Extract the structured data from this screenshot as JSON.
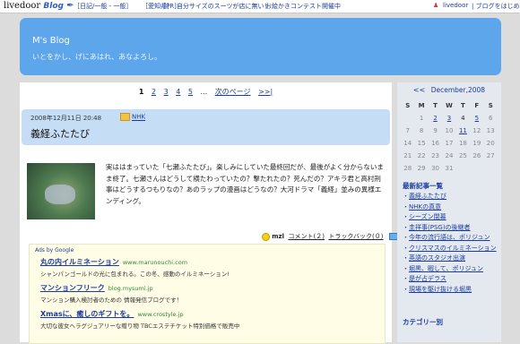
{
  "topbar": {
    "logo_text": "livedoor",
    "logo_blog": "Blog",
    "link1": "［日記/一般 - 一般］",
    "link2": "［愛知県］",
    "link3": "［PR]自分サイズのスーツが店に無い！",
    "link4": "お絵かきコンテスト開催中",
    "right1": "livedoor",
    "right2": "| ブログをはじめる"
  },
  "header": {
    "title": "M's Blog",
    "description": "いとをかし、げにあはれ、あなよろし。"
  },
  "pager": {
    "pages": [
      "1",
      "2",
      "3",
      "4",
      "5"
    ],
    "ellipsis": "...",
    "next": "次のページ",
    "last": ">>|"
  },
  "post": {
    "date": "2008年12月11日 20:48",
    "category": "NHK",
    "title": "義経ふたたび",
    "body": "実ははまっていた「七瀬ふたたび」。楽しみにしていた最終回だが、最後がよく分からないまま終了。七瀬さんはどうして横たわっていたの？撃たれたの？死んだの？アキラ君と高村刑事はどうするつもりなの？あのラップの漫画はどうなの？大河ドラマ「義経」並みの異様エンディング。",
    "author": "mzl",
    "comments": "コメント(２)",
    "trackback": "トラックバック(０)"
  },
  "ads": {
    "label": "Ads by Google",
    "items": [
      {
        "title": "丸の内イルミネーション",
        "url": "www.marunouchi.com",
        "desc": "シャンパンゴールドの光に包まれる。この冬、感動のイルミネーション!"
      },
      {
        "title": "マンションフリーク",
        "url": "blog.mysumi.jp",
        "desc": "マンション購入検討者のための 情報発信ブログです！"
      },
      {
        "title": "Xmasに、癒しのギフトを。",
        "url": "www.crostyle.jp",
        "desc": "大切な彼女へラグジュアリーな贈り物 TBCエステチケット特別価格で販売中"
      }
    ]
  },
  "calendar": {
    "prev": "<<",
    "title": "December,2008",
    "days": [
      "S",
      "M",
      "T",
      "W",
      "T",
      "F",
      "S"
    ],
    "rows": [
      [
        "",
        "1",
        "2",
        "3",
        "4",
        "5",
        "6"
      ],
      [
        "7",
        "8",
        "9",
        "10",
        "11",
        "12",
        "13"
      ],
      [
        "14",
        "15",
        "16",
        "17",
        "18",
        "19",
        "20"
      ],
      [
        "21",
        "22",
        "23",
        "24",
        "25",
        "26",
        "27"
      ],
      [
        "28",
        "29",
        "30",
        "31",
        "",
        "",
        ""
      ]
    ]
  },
  "recent": {
    "heading": "最新記事一覧",
    "items": [
      "義経ふたたび",
      "NHKの真意",
      "シーズン閉幕",
      "圭祥事(PSG)の後継者",
      "今年の流行語は、ポリジュン",
      "クリスマスのイルミネーション",
      "英語のスタジオ出演",
      "堀黒、暇して、ポリジュン",
      "是が占デラス",
      "現場を駆け抜ける堀黒"
    ]
  },
  "category_heading": "カテゴリー別"
}
